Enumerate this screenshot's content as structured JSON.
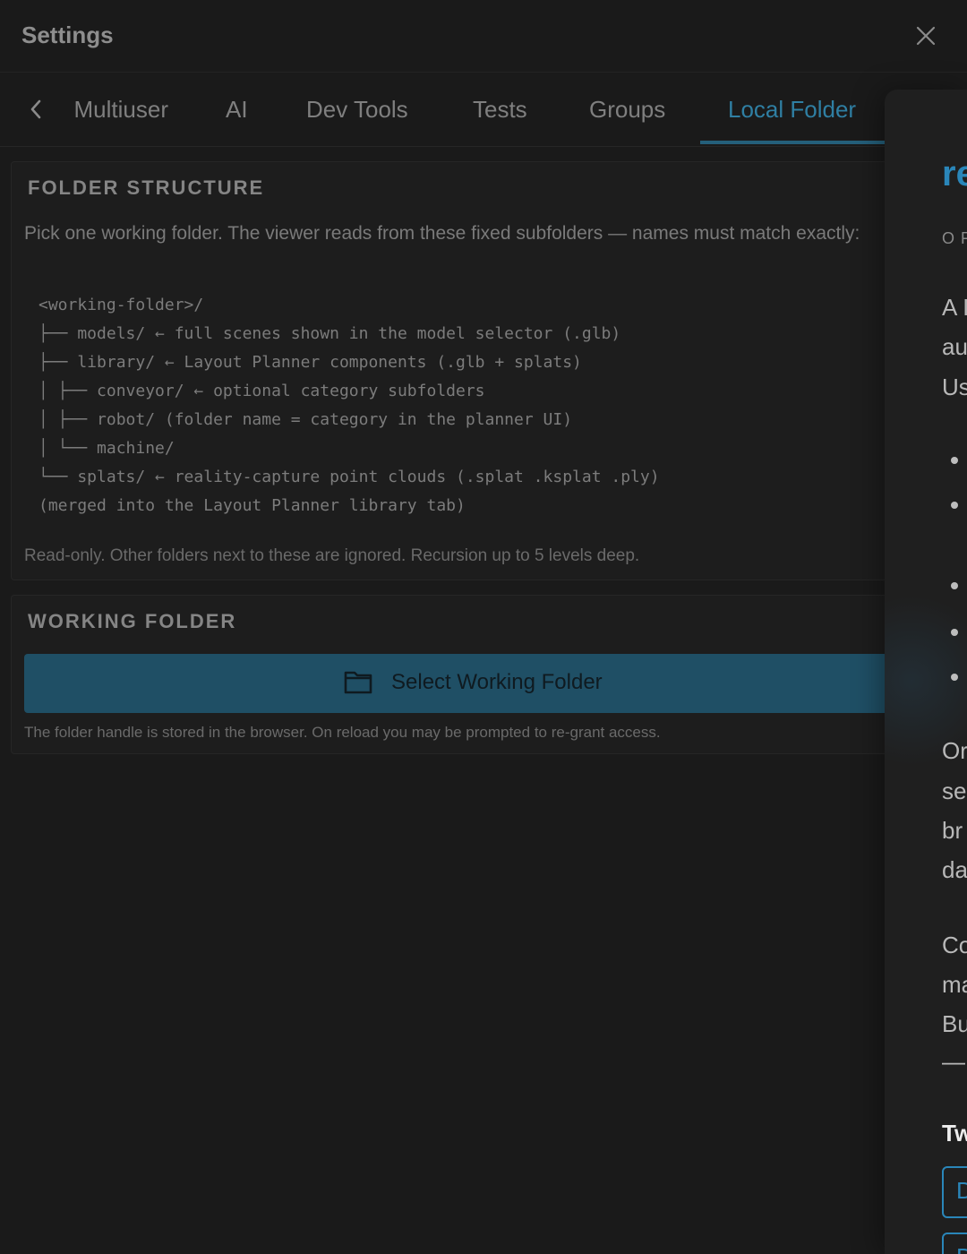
{
  "header": {
    "title": "Settings"
  },
  "tabs": [
    {
      "label": "Multiuser"
    },
    {
      "label": "AI"
    },
    {
      "label": "Dev Tools"
    },
    {
      "label": "Tests"
    },
    {
      "label": "Groups"
    },
    {
      "label": "Local Folder"
    }
  ],
  "folder_structure": {
    "title": "FOLDER STRUCTURE",
    "description": "Pick one working folder. The viewer reads from these fixed subfolders — names must match exactly:",
    "tree": "<working-folder>/\n├── models/ ← full scenes shown in the model selector (.glb)\n├── library/ ← Layout Planner components (.glb + splats)\n│ ├── conveyor/ ← optional category subfolders\n│ ├── robot/ (folder name = category in the planner UI)\n│ └── machine/\n└── splats/ ← reality-capture point clouds (.splat .ksplat .ply)\n(merged into the Layout Planner library tab)",
    "note": "Read-only. Other folders next to these are ignored. Recursion up to 5 levels deep."
  },
  "working_folder": {
    "title": "WORKING FOLDER",
    "button_label": "Select Working Folder",
    "note": "The folder handle is stored in the browser. On reload you may be prompted to re-grant access."
  },
  "drawer": {
    "heading": "re",
    "sub": "O F",
    "text_lines": [
      "A I",
      "au",
      "Us",
      "Or",
      "se",
      "br",
      "da",
      "Co",
      "ma",
      "Bu",
      "—"
    ],
    "bold": "Tw",
    "outline_letters": [
      "D",
      "D"
    ]
  },
  "colors": {
    "accent": "#2a86b9",
    "button_bg": "#1f4f65",
    "background": "#1a1a1a"
  }
}
